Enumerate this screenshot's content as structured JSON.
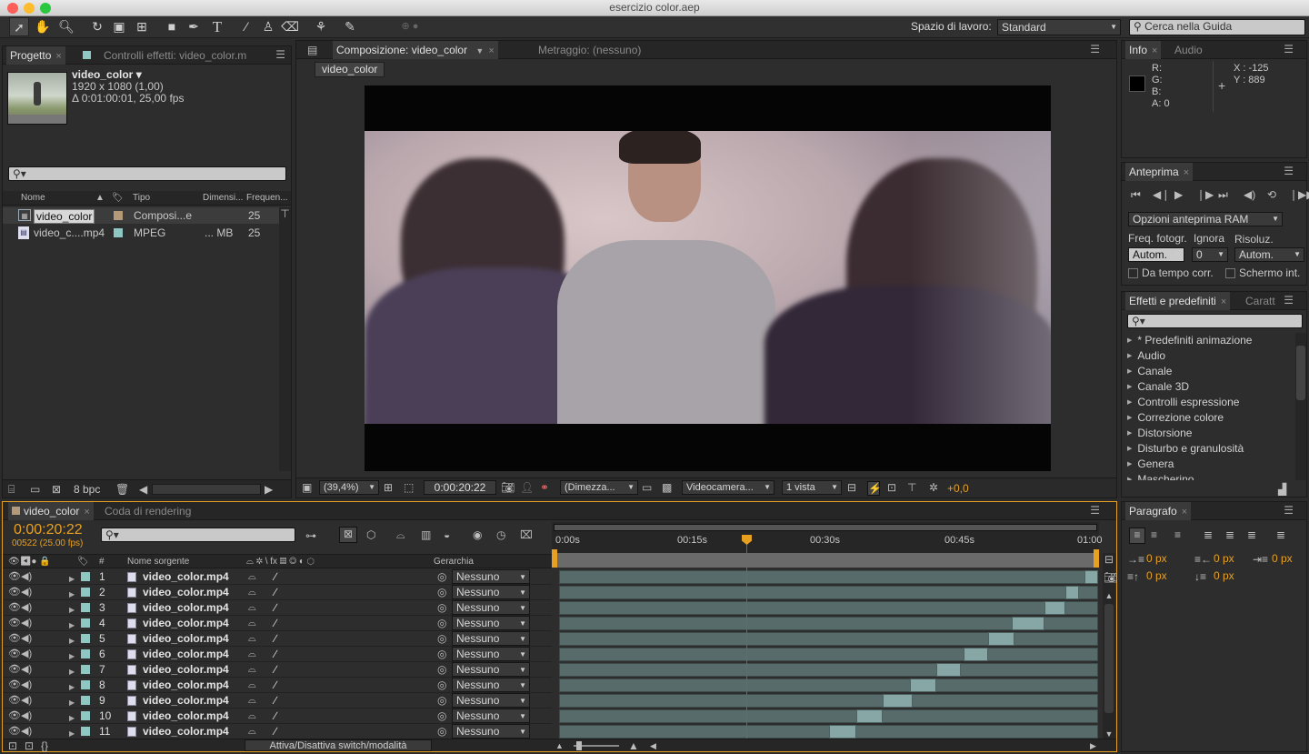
{
  "window": {
    "title": "esercizio color.aep"
  },
  "workspace": {
    "label": "Spazio di lavoro:",
    "value": "Standard",
    "search_placeholder": "Cerca nella Guida"
  },
  "project": {
    "tabs": [
      "Progetto",
      "Controlli effetti: video_color.m"
    ],
    "item_name": "video_color ▾",
    "item_dims": "1920 x 1080 (1,00)",
    "item_duration": "Δ 0:01:00:01, 25,00 fps",
    "columns": [
      "Nome",
      "Tipo",
      "Dimensi...",
      "Frequen..."
    ],
    "rows": [
      {
        "name": "video_color",
        "type": "Composi...e",
        "size": "",
        "fps": "25"
      },
      {
        "name": "video_c....mp4",
        "type": "MPEG",
        "size": "... MB",
        "fps": "25"
      }
    ],
    "bpc": "8 bpc"
  },
  "comp": {
    "tabs": [
      "Composizione: video_color",
      "Metraggio: (nessuno)"
    ],
    "breadcrumb": "video_color",
    "zoom": "(39,4%)",
    "timecode": "0:00:20:22",
    "resolution": "(Dimezza...",
    "camera": "Videocamera...",
    "views": "1 vista",
    "exposure": "+0,0"
  },
  "info": {
    "tabs": [
      "Info",
      "Audio"
    ],
    "r": "R:",
    "g": "G:",
    "b": "B:",
    "a": "A:  0",
    "x": "X : -125",
    "y": "Y : 889"
  },
  "preview": {
    "tab": "Anteprima",
    "ram_options": "Opzioni anteprima RAM",
    "frame_rate_label": "Freq. fotogr.",
    "skip_label": "Ignora",
    "res_label": "Risoluz.",
    "frame_rate": "Autom.",
    "skip": "0",
    "res": "Autom.",
    "from_current": "Da tempo corr.",
    "full_screen": "Schermo int."
  },
  "effects": {
    "tabs": [
      "Effetti e predefiniti",
      "Caratt"
    ],
    "items": [
      "* Predefiniti animazione",
      "Audio",
      "Canale",
      "Canale 3D",
      "Controlli espressione",
      "Correzione colore",
      "Distorsione",
      "Disturbo e granulosità",
      "Genera",
      "Mascherino"
    ]
  },
  "paragraph": {
    "tab": "Paragrafo",
    "px1": "0 px",
    "px2": "0 px",
    "px3": "0 px",
    "px4": "0 px",
    "px5": "0 px"
  },
  "timeline": {
    "tabs": [
      "video_color",
      "Coda di rendering"
    ],
    "timecode": "0:00:20:22",
    "frame_info": "00522 (25.00 fps)",
    "col_source": "Nome sorgente",
    "col_parent": "Gerarchia",
    "col_num": "#",
    "ruler": [
      "0:00s",
      "00:15s",
      "00:30s",
      "00:45s",
      "01:00"
    ],
    "toggle_label": "Attiva/Disattiva switch/modalità",
    "layers": [
      {
        "num": "1",
        "name": "video_color.mp4",
        "parent": "Nessuno",
        "in": 0.975,
        "out": 1.0
      },
      {
        "num": "2",
        "name": "video_color.mp4",
        "parent": "Nessuno",
        "in": 0.94,
        "out": 0.965
      },
      {
        "num": "3",
        "name": "video_color.mp4",
        "parent": "Nessuno",
        "in": 0.9,
        "out": 0.94
      },
      {
        "num": "4",
        "name": "video_color.mp4",
        "parent": "Nessuno",
        "in": 0.84,
        "out": 0.9
      },
      {
        "num": "5",
        "name": "video_color.mp4",
        "parent": "Nessuno",
        "in": 0.795,
        "out": 0.845
      },
      {
        "num": "6",
        "name": "video_color.mp4",
        "parent": "Nessuno",
        "in": 0.75,
        "out": 0.795
      },
      {
        "num": "7",
        "name": "video_color.mp4",
        "parent": "Nessuno",
        "in": 0.7,
        "out": 0.745
      },
      {
        "num": "8",
        "name": "video_color.mp4",
        "parent": "Nessuno",
        "in": 0.65,
        "out": 0.7
      },
      {
        "num": "9",
        "name": "video_color.mp4",
        "parent": "Nessuno",
        "in": 0.6,
        "out": 0.655
      },
      {
        "num": "10",
        "name": "video_color.mp4",
        "parent": "Nessuno",
        "in": 0.55,
        "out": 0.6
      },
      {
        "num": "11",
        "name": "video_color.mp4",
        "parent": "Nessuno",
        "in": 0.5,
        "out": 0.55
      }
    ],
    "playhead": 0.348
  },
  "colors": {
    "accent": "#e8a020",
    "label_teal": "#8fc7c2",
    "playhead": "#d63a3a"
  }
}
